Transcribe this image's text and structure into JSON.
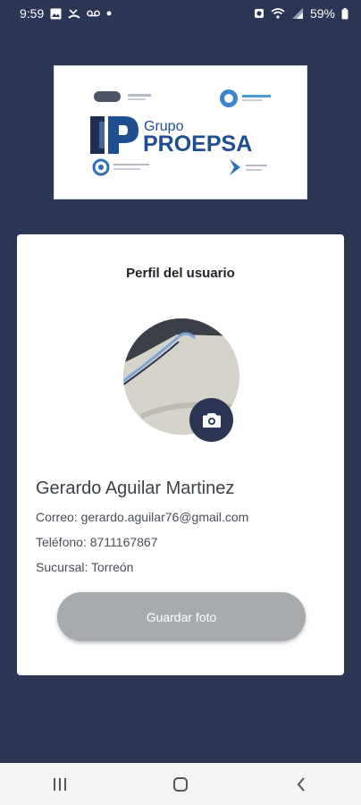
{
  "status_bar": {
    "time": "9:59",
    "battery": "59%",
    "left_icons": [
      "image-icon",
      "missed-call-icon",
      "voicemail-icon",
      "dot-icon"
    ],
    "right_icons": [
      "alarm-icon",
      "wifi-icon",
      "signal-icon",
      "battery-icon"
    ]
  },
  "logo": {
    "mark": "IP",
    "line1": "Grupo",
    "line2": "PROEPSA"
  },
  "profile": {
    "title": "Perfil del usuario",
    "name": "Gerardo Aguilar Martinez",
    "email_line": "Correo: gerardo.aguilar76@gmail.com",
    "phone_line": "Teléfono: 8711167867",
    "branch_line": "Sucursal: Torreón",
    "save_button": "Guardar foto"
  },
  "colors": {
    "background": "#2b3655",
    "button_disabled": "#a7abb0",
    "camera_button": "#2b3655"
  }
}
